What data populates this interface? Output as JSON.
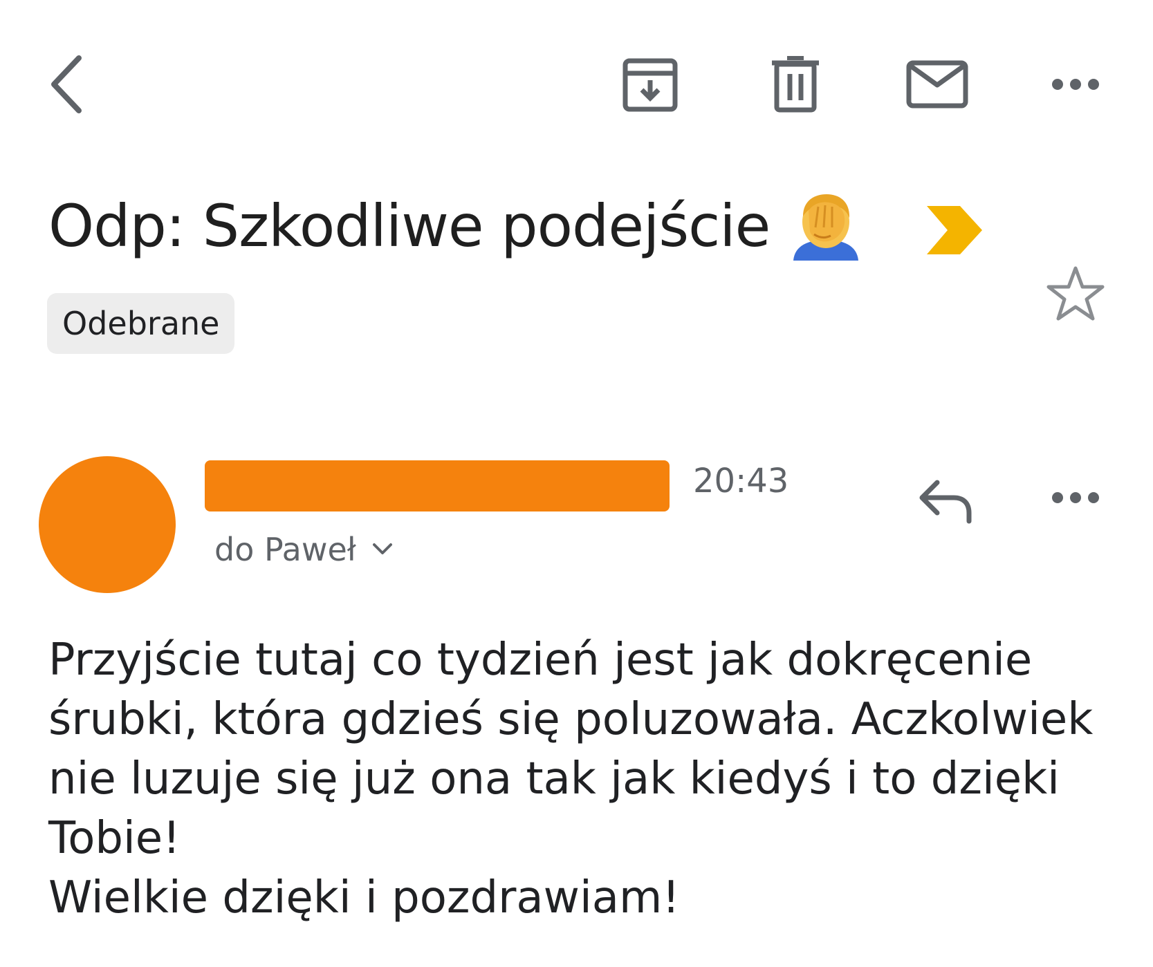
{
  "toolbar": {
    "back_icon": "chevron-left-icon",
    "archive_icon": "archive-icon",
    "delete_icon": "trash-icon",
    "mark_unread_icon": "mail-icon",
    "more_icon": "more-horizontal-icon"
  },
  "email": {
    "subject": "Odp: Szkodliwe podejście",
    "subject_emoji": "facepalm-emoji",
    "importance_marker": "importance-marker-icon",
    "starred": false,
    "label": "Odebrane",
    "sender": {
      "avatar_color": "#f5820d",
      "name_redacted_color": "#f5820d"
    },
    "time": "20:43",
    "recipients": "do Paweł",
    "body_lines": [
      "Przyjście tutaj co tydzień jest jak dokręcenie",
      "śrubki, która gdzieś się poluzowała. Aczkolwiek",
      "nie luzuje się już ona tak jak kiedyś i to dzięki",
      "Tobie!",
      "Wielkie dzięki i pozdrawiam!"
    ]
  },
  "colors": {
    "accent_orange": "#f5820d",
    "importance_yellow": "#f4b400",
    "icon_gray": "#5f6368",
    "chip_bg": "#ededed"
  }
}
